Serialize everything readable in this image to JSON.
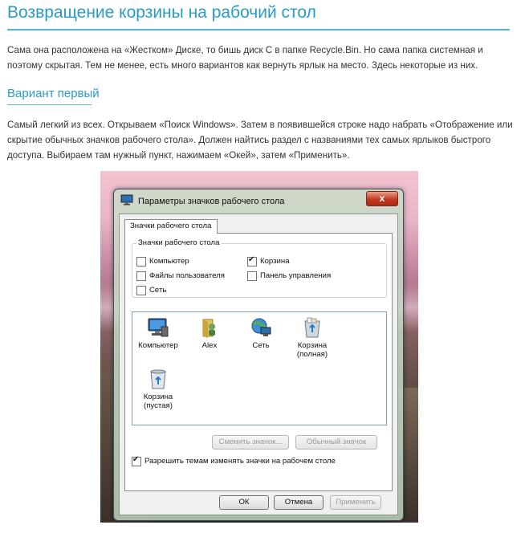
{
  "article": {
    "title": "Возвращение корзины на рабочий стол",
    "intro": "Сама она расположена на «Жестком» Диске, то бишь диск C в папке Recycle.Bin. Но сама папка системная и поэтому скрытая. Тем не менее, есть много вариантов как вернуть ярлык на место. Здесь некоторые из них.",
    "subheading": "Вариант первый",
    "body": "Самый легкий из всех. Открываем «Поиск Windows». Затем в появившейся строке надо набрать «Отображение или скрытие обычных значков рабочего стола». Должен найтись раздел с названиями тех самых ярлыков быстрого доступа. Выбираем там нужный пункт, нажимаем «Окей», затем «Применить»."
  },
  "dialog": {
    "title": "Параметры значков рабочего стола",
    "close_label": "x",
    "tab_label": "Значки рабочего стола",
    "group_label": "Значки рабочего стола",
    "checkboxes": [
      {
        "label": "Компьютер",
        "checked": false
      },
      {
        "label": "Файлы пользователя",
        "checked": false
      },
      {
        "label": "Сеть",
        "checked": false
      },
      {
        "label": "Корзина",
        "checked": true
      },
      {
        "label": "Панель управления",
        "checked": false
      }
    ],
    "icons": [
      {
        "label": "Компьютер",
        "icon": "computer-icon"
      },
      {
        "label": "Alex",
        "icon": "user-folder-icon"
      },
      {
        "label": "Сеть",
        "icon": "network-icon"
      },
      {
        "label": "Корзина (полная)",
        "icon": "recycle-bin-full-icon"
      },
      {
        "label": "Корзина (пустая)",
        "icon": "recycle-bin-empty-icon"
      }
    ],
    "change_icon_label": "Сменить значок...",
    "default_icon_label": "Обычный значок",
    "themes_checkbox_label": "Разрешить темам изменять значки на рабочем столе",
    "themes_checked": true,
    "ok_label": "ОК",
    "cancel_label": "Отмена",
    "apply_label": "Применить"
  }
}
